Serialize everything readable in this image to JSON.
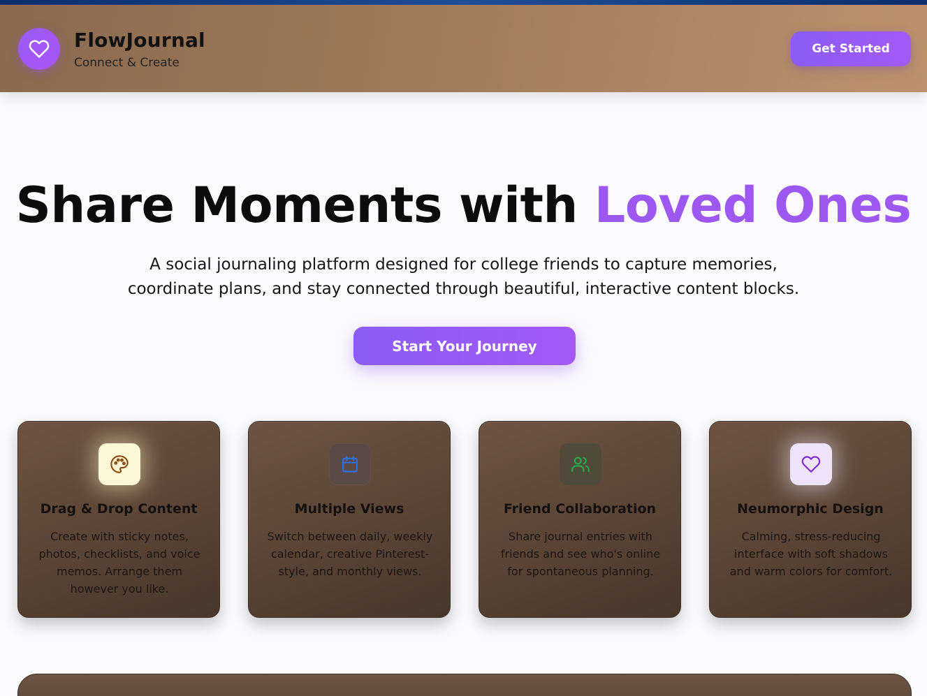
{
  "header": {
    "brand_name": "FlowJournal",
    "brand_tagline": "Connect & Create",
    "logo_icon": "heart-icon",
    "get_started_label": "Get Started"
  },
  "hero": {
    "title_main": "Share Moments with ",
    "title_accent": "Loved Ones",
    "subtitle_line1": "A social journaling platform designed for college friends to capture memories,",
    "subtitle_line2": "coordinate plans, and stay connected through beautiful, interactive content blocks.",
    "cta_label": "Start Your Journey"
  },
  "features": [
    {
      "icon": "palette-icon",
      "title": "Drag & Drop Content",
      "description": "Create with sticky notes, photos, checklists, and voice memos. Arrange them however you like.",
      "icon_color": "#8a4b12",
      "icon_bg": "#fdf7d6"
    },
    {
      "icon": "calendar-icon",
      "title": "Multiple Views",
      "description": "Switch between daily, weekly calendar, creative Pinterest-style, and monthly views.",
      "icon_color": "#2f6fe0",
      "icon_bg": "#5a4a44"
    },
    {
      "icon": "users-icon",
      "title": "Friend Collaboration",
      "description": "Share journal entries with friends and see who's online for spontaneous planning.",
      "icon_color": "#2aa84a",
      "icon_bg": "#4e4a38"
    },
    {
      "icon": "heart-icon",
      "title": "Neumorphic Design",
      "description": "Calming, stress-reducing interface with soft shadows and warm colors for comfort.",
      "icon_color": "#7b2fd0",
      "icon_bg": "#efe3fb"
    }
  ],
  "colors": {
    "accent": "#9d58f2",
    "header_start": "#8b6a4e",
    "header_end": "#bb926b",
    "card": "#5a4435"
  }
}
